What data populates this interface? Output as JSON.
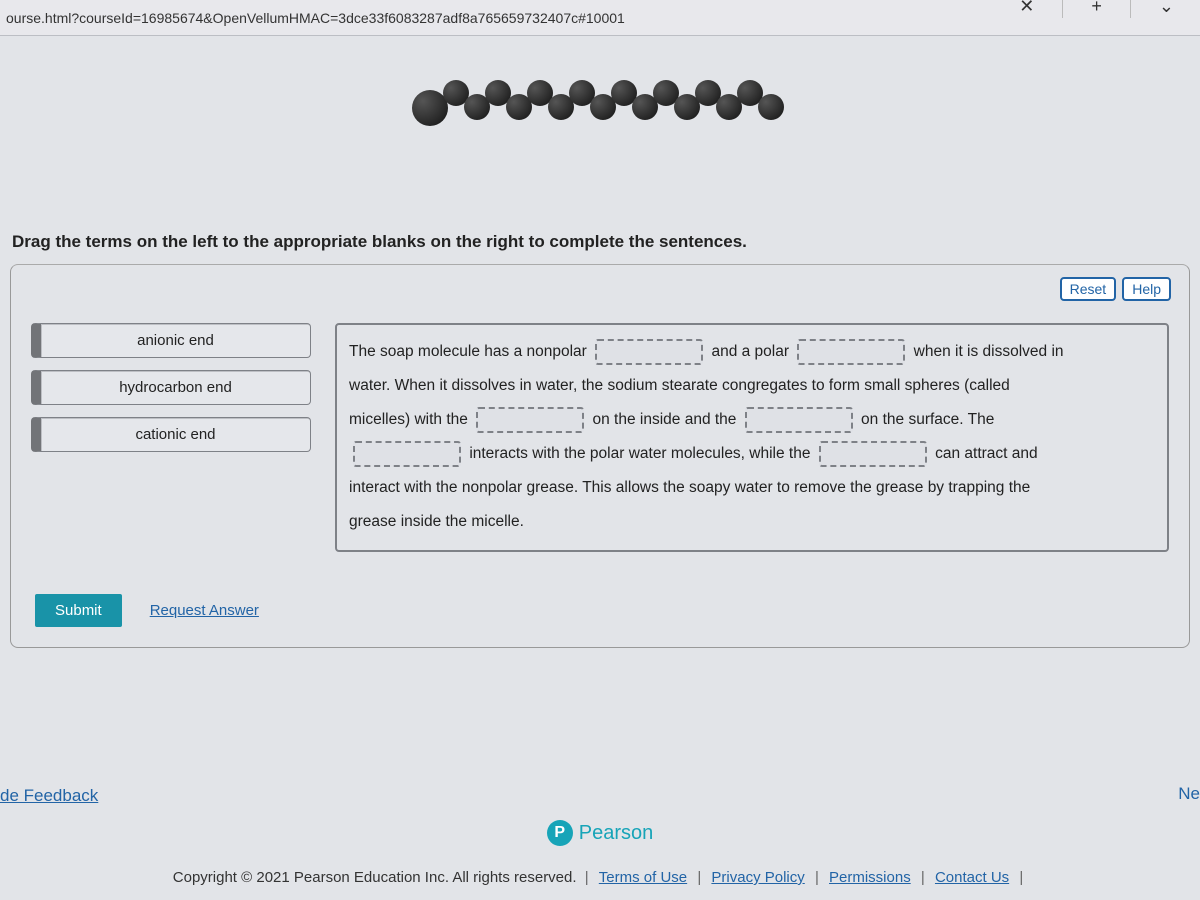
{
  "browser": {
    "url_fragment": "ourse.html?courseId=16985674&OpenVellumHMAC=3dce33f6083287adf8a765659732407c#10001",
    "tab_close": "✕",
    "tab_new": "+",
    "tab_more": "⌄"
  },
  "instructions": "Drag the terms on the left to the appropriate blanks on the right to complete the sentences.",
  "controls": {
    "reset": "Reset",
    "help": "Help"
  },
  "terms": [
    "anionic end",
    "hydrocarbon end",
    "cationic end"
  ],
  "sentence": {
    "s1a": "The soap molecule has a nonpolar",
    "s1b": "and a polar",
    "s1c": "when it is dissolved in",
    "s2": "water. When it dissolves in water, the sodium stearate congregates to form small spheres (called",
    "s3a": "micelles) with the",
    "s3b": "on the inside and the",
    "s3c": "on the surface. The",
    "s4a": "interacts with the polar water molecules, while the",
    "s4b": "can attract and",
    "s5": "interact with the nonpolar grease. This allows the soapy water to remove the grease by trapping the",
    "s6": "grease inside the micelle."
  },
  "submit": {
    "button": "Submit",
    "request_answer": "Request Answer"
  },
  "feedback_link": "de Feedback",
  "next_hint": "Ne",
  "pearson": {
    "p": "P",
    "name": "Pearson"
  },
  "footer": {
    "copyright": "Copyright © 2021 Pearson Education Inc. All rights reserved.",
    "terms": "Terms of Use",
    "privacy": "Privacy Policy",
    "permissions": "Permissions",
    "contact": "Contact Us"
  }
}
